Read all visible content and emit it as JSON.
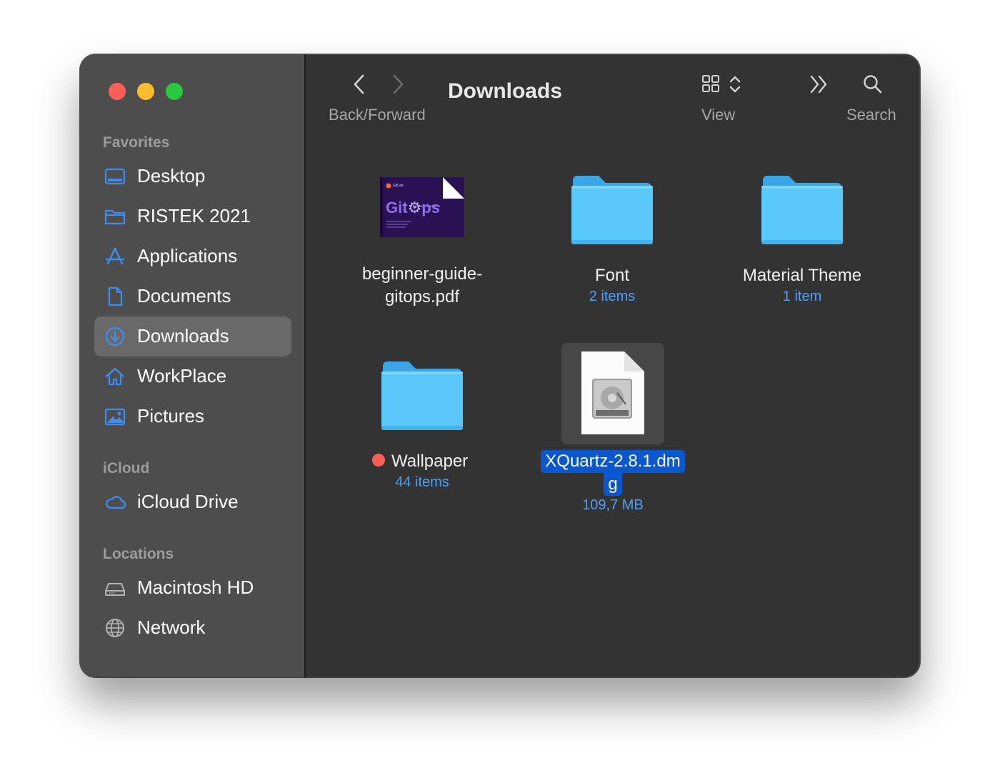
{
  "window": {
    "title": "Downloads",
    "traffic_lights": [
      "close",
      "minimize",
      "zoom"
    ]
  },
  "toolbar": {
    "back_forward_label": "Back/Forward",
    "view_label": "View",
    "search_label": "Search",
    "icons": [
      "chevron-left-icon",
      "chevron-right-icon",
      "grid-view-icon",
      "sort-arrows-icon",
      "double-chevron-icon",
      "search-icon"
    ]
  },
  "sidebar": {
    "favorites_title": "Favorites",
    "icloud_title": "iCloud",
    "locations_title": "Locations",
    "items": [
      {
        "label": "Desktop",
        "icon": "desktop-icon"
      },
      {
        "label": "RISTEK 2021",
        "icon": "folder-icon"
      },
      {
        "label": "Applications",
        "icon": "applications-icon"
      },
      {
        "label": "Documents",
        "icon": "document-icon"
      },
      {
        "label": "Downloads",
        "icon": "download-icon",
        "selected": true
      },
      {
        "label": "WorkPlace",
        "icon": "home-icon"
      },
      {
        "label": "Pictures",
        "icon": "pictures-icon"
      },
      {
        "label": "iCloud Drive",
        "icon": "cloud-icon"
      },
      {
        "label": "Macintosh HD",
        "icon": "drive-icon"
      },
      {
        "label": "Network",
        "icon": "globe-icon"
      }
    ]
  },
  "files": [
    {
      "name_line1": "beginner-guide-",
      "name_line2": "gitops.pdf",
      "kind": "pdf",
      "thumb_brand": "GitLab",
      "thumb_title": "Git",
      "thumb_title_end": "ps"
    },
    {
      "name": "Font",
      "meta": "2 items",
      "kind": "folder"
    },
    {
      "name": "Material Theme",
      "meta": "1 item",
      "kind": "folder"
    },
    {
      "name": "Wallpaper",
      "meta": "44 items",
      "kind": "folder",
      "tag_color": "#ff5e57"
    },
    {
      "name_line1": "XQuartz-2.8.1.dm",
      "name_line2": "g",
      "meta": "109,7 MB",
      "kind": "dmg",
      "selected": true
    }
  ],
  "colors": {
    "accent": "#0a57d0",
    "folder": "#5ac8fa",
    "meta_text": "#4f9ff7",
    "sidebar_icon": "#3d8ef2"
  }
}
